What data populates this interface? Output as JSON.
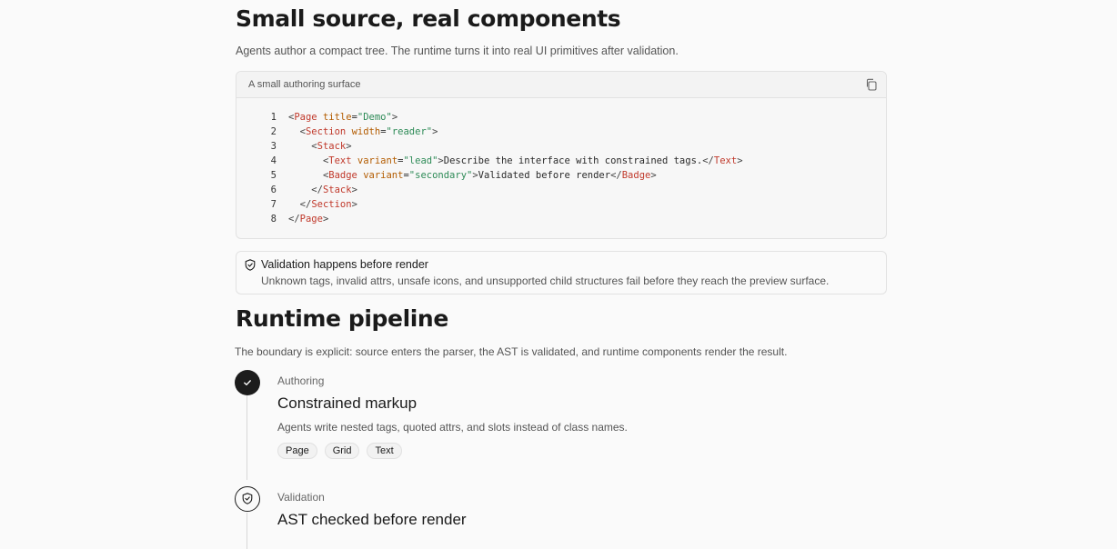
{
  "section1": {
    "title": "Small source, real components",
    "lead": "Agents author a compact tree. The runtime turns it into real UI primitives after validation."
  },
  "codecard": {
    "caption": "A small authoring surface",
    "copy_icon": "copy-icon",
    "lines": [
      {
        "n": "1",
        "text": "<Page title=\"Demo\">"
      },
      {
        "n": "2",
        "text": "  <Section width=\"reader\">"
      },
      {
        "n": "3",
        "text": "    <Stack>"
      },
      {
        "n": "4",
        "text": "      <Text variant=\"lead\">Describe the interface with constrained tags.</Text>"
      },
      {
        "n": "5",
        "text": "      <Badge variant=\"secondary\">Validated before render</Badge>"
      },
      {
        "n": "6",
        "text": "    </Stack>"
      },
      {
        "n": "7",
        "text": "  </Section>"
      },
      {
        "n": "8",
        "text": "</Page>"
      }
    ]
  },
  "callout": {
    "icon": "shield-check-icon",
    "title": "Validation happens before render",
    "body": "Unknown tags, invalid attrs, unsafe icons, and unsupported child structures fail before they reach the preview surface."
  },
  "section2": {
    "title": "Runtime pipeline",
    "lead": "The boundary is explicit: source enters the parser, the AST is validated, and runtime components render the result."
  },
  "steps": [
    {
      "eyebrow": "Authoring",
      "title": "Constrained markup",
      "desc": "Agents write nested tags, quoted attrs, and slots instead of class names.",
      "chips": [
        "Page",
        "Grid",
        "Text"
      ],
      "status": "done",
      "icon": "check-icon"
    },
    {
      "eyebrow": "Validation",
      "title": "AST checked before render",
      "status": "active",
      "icon": "shield-check-icon"
    }
  ],
  "colors": {
    "background": "#fafafa",
    "tag": "#c0392b",
    "attr": "#b35c00",
    "string": "#2e8b57",
    "step_done": "#1c1c1c"
  }
}
